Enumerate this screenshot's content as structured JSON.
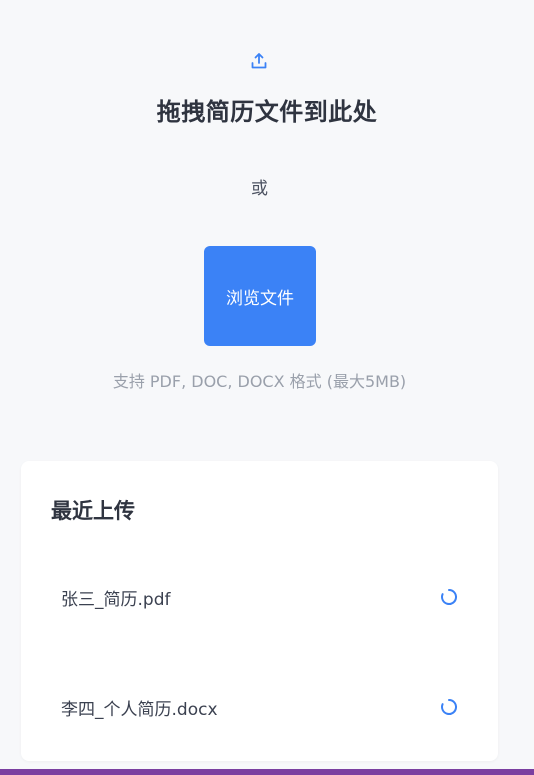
{
  "upload": {
    "icon": "upload-icon",
    "title": "拖拽简历文件到此处",
    "or_text": "或",
    "browse_label": "浏览文件",
    "format_hint": "支持 PDF, DOC, DOCX 格式 (最大5MB)"
  },
  "recent": {
    "title": "最近上传",
    "files": [
      {
        "name": "张三_简历.pdf",
        "status_icon": "loading-spinner-icon"
      },
      {
        "name": "李四_个人简历.docx",
        "status_icon": "loading-spinner-icon"
      }
    ]
  },
  "colors": {
    "accent": "#3b82f6",
    "background": "#f7f8fa",
    "card": "#ffffff",
    "bottom_bar": "#7b3fa0"
  }
}
